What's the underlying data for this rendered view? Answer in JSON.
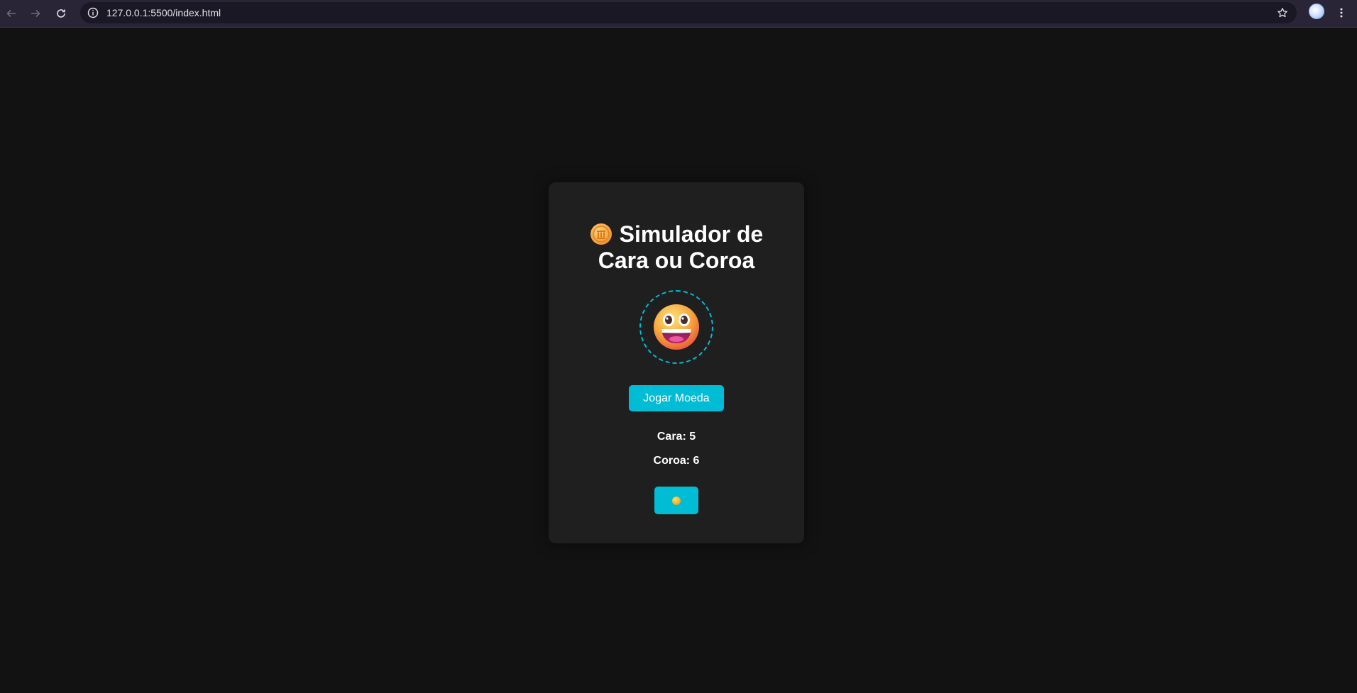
{
  "browser": {
    "url": "127.0.0.1:5500/index.html",
    "icons": {
      "back": "arrow-left-icon",
      "forward": "arrow-right-icon",
      "reload": "reload-icon",
      "site_info": "info-icon",
      "bookmark": "star-icon",
      "menu": "more-vertical-icon"
    }
  },
  "app": {
    "title_line1": "Simulador de",
    "title_line2": "Cara ou Coroa",
    "title_icon": "coin-icon",
    "result_icon": "grinning-face-icon",
    "flip_button_label": "Jogar Moeda",
    "heads_label": "Cara",
    "heads_count": 5,
    "tails_label": "Coroa",
    "tails_count": 6,
    "theme_toggle_icon": "sun-icon"
  },
  "colors": {
    "page_background": "#121212",
    "card_background": "#1f1f1f",
    "accent": "#00bcd4",
    "text": "#ffffff"
  }
}
